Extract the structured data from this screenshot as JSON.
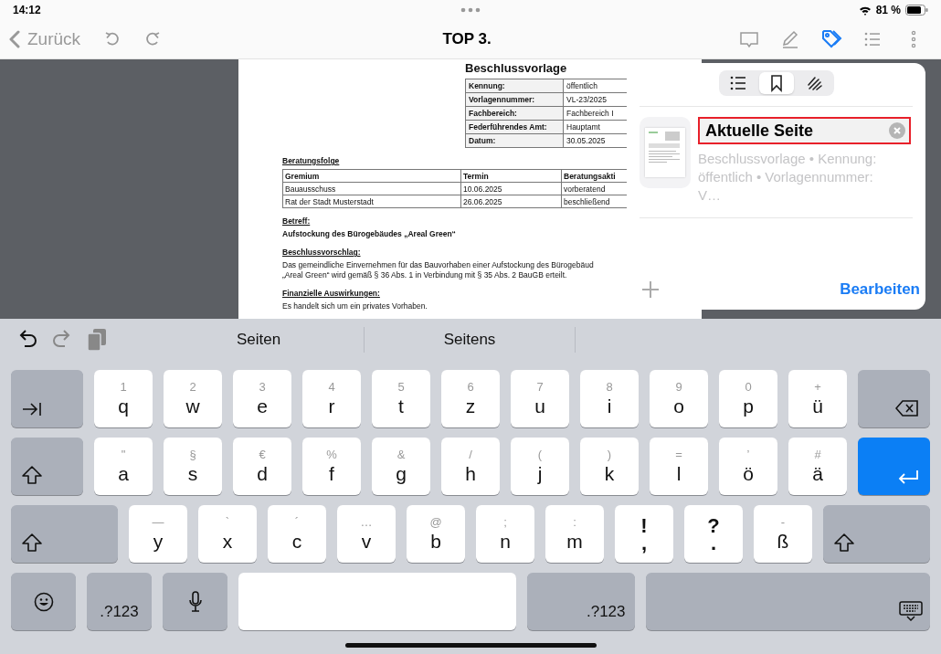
{
  "status_bar": {
    "time": "14:12",
    "battery": "81 %"
  },
  "nav": {
    "back": "Zurück",
    "title": "TOP 3.",
    "tools": [
      {
        "kind": "comment",
        "selected": false
      },
      {
        "kind": "pencil",
        "selected": false
      },
      {
        "kind": "tag",
        "selected": true
      },
      {
        "kind": "list",
        "selected": false
      },
      {
        "kind": "more",
        "selected": false
      }
    ]
  },
  "document": {
    "title": "Beschlussvorlage",
    "meta": [
      [
        "Kennung:",
        "öffentlich"
      ],
      [
        "Vorlagennummer:",
        "VL-23/2025"
      ],
      [
        "Fachbereich:",
        "Fachbereich I"
      ],
      [
        "Federführendes Amt:",
        "Hauptamt"
      ],
      [
        "Datum:",
        "30.05.2025"
      ]
    ],
    "sequence_heading": "Beratungsfolge",
    "sequence_columns": [
      "Gremium",
      "Termin",
      "Beratungsakti"
    ],
    "sequence_rows": [
      [
        "Bauausschuss",
        "10.06.2025",
        "vorberatend"
      ],
      [
        "Rat der Stadt Musterstadt",
        "26.06.2025",
        "beschließend"
      ]
    ],
    "sections": [
      {
        "heading": "Betreff:",
        "lines": [
          "Aufstockung des Bürogebäudes „Areal Green“"
        ],
        "bold": true
      },
      {
        "heading": "Beschlussvorschlag:",
        "lines": [
          "Das gemeindliche Einvernehmen für das Bauvorhaben einer Aufstockung des Bürogebäud",
          "„Areal Green“ wird gemäß § 36 Abs. 1 in Verbindung mit § 35 Abs. 2 BauGB erteilt."
        ],
        "bold": false
      },
      {
        "heading": "Finanzielle Auswirkungen:",
        "lines": [
          "Es handelt sich um ein privates Vorhaben."
        ],
        "bold": false
      }
    ]
  },
  "popover": {
    "segments": [
      {
        "kind": "list",
        "selected": false
      },
      {
        "kind": "bookmark",
        "selected": true
      },
      {
        "kind": "scribble",
        "selected": false
      }
    ],
    "bookmark": {
      "value": "Aktuelle Seite",
      "highlighted": true,
      "preview": "Beschlussvorlage • Kennung: öffentlich • Vorlagennummer: V…"
    },
    "edit": "Bearbeiten"
  },
  "keyboard": {
    "suggestions": [
      "Seiten",
      "Seitens"
    ],
    "rows": [
      {
        "keys": [
          {
            "kind": "tab"
          },
          {
            "kind": "letter",
            "label": "q",
            "hint": "1"
          },
          {
            "kind": "letter",
            "label": "w",
            "hint": "2"
          },
          {
            "kind": "letter",
            "label": "e",
            "hint": "3"
          },
          {
            "kind": "letter",
            "label": "r",
            "hint": "4"
          },
          {
            "kind": "letter",
            "label": "t",
            "hint": "5"
          },
          {
            "kind": "letter",
            "label": "z",
            "hint": "6"
          },
          {
            "kind": "letter",
            "label": "u",
            "hint": "7"
          },
          {
            "kind": "letter",
            "label": "i",
            "hint": "8"
          },
          {
            "kind": "letter",
            "label": "o",
            "hint": "9"
          },
          {
            "kind": "letter",
            "label": "p",
            "hint": "0"
          },
          {
            "kind": "letter",
            "label": "ü",
            "hint": "+"
          },
          {
            "kind": "delete"
          }
        ]
      },
      {
        "keys": [
          {
            "kind": "shift"
          },
          {
            "kind": "letter",
            "label": "a",
            "hint": "\""
          },
          {
            "kind": "letter",
            "label": "s",
            "hint": "§"
          },
          {
            "kind": "letter",
            "label": "d",
            "hint": "€"
          },
          {
            "kind": "letter",
            "label": "f",
            "hint": "%"
          },
          {
            "kind": "letter",
            "label": "g",
            "hint": "&"
          },
          {
            "kind": "letter",
            "label": "h",
            "hint": "/"
          },
          {
            "kind": "letter",
            "label": "j",
            "hint": "("
          },
          {
            "kind": "letter",
            "label": "k",
            "hint": ")"
          },
          {
            "kind": "letter",
            "label": "l",
            "hint": "="
          },
          {
            "kind": "letter",
            "label": "ö",
            "hint": "’"
          },
          {
            "kind": "letter",
            "label": "ä",
            "hint": "#"
          },
          {
            "kind": "return"
          }
        ]
      },
      {
        "keys": [
          {
            "kind": "shift"
          },
          {
            "kind": "letter",
            "label": "y",
            "hint": "—"
          },
          {
            "kind": "letter",
            "label": "x",
            "hint": "`"
          },
          {
            "kind": "letter",
            "label": "c",
            "hint": "´"
          },
          {
            "kind": "letter",
            "label": "v",
            "hint": "…"
          },
          {
            "kind": "letter",
            "label": "b",
            "hint": "@"
          },
          {
            "kind": "letter",
            "label": "n",
            "hint": ";"
          },
          {
            "kind": "letter",
            "label": "m",
            "hint": ":"
          },
          {
            "kind": "punct",
            "label": ",",
            "hint": "!"
          },
          {
            "kind": "punct",
            "label": ".",
            "hint": "?"
          },
          {
            "kind": "letter",
            "label": "ß",
            "hint": "-"
          },
          {
            "kind": "shift"
          }
        ]
      },
      {
        "keys": [
          {
            "kind": "emoji"
          },
          {
            "kind": "symbols",
            "label": ".?123"
          },
          {
            "kind": "mic"
          },
          {
            "kind": "space"
          },
          {
            "kind": "symbols",
            "label": ".?123"
          },
          {
            "kind": "hide"
          }
        ]
      }
    ]
  }
}
